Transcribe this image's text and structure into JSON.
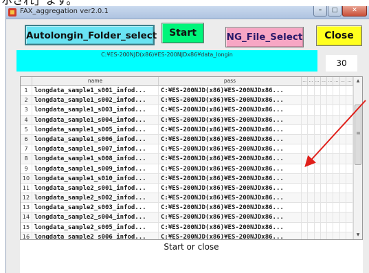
{
  "outside_text": "ホされ」ます。",
  "window": {
    "title": "FAX_aggregation  ver2.0.1",
    "controls": {
      "minimize": "–",
      "maximize": "□",
      "close": "✕"
    }
  },
  "toolbar": {
    "autologin_label": "Autolongin_Folder_select",
    "start_label": "Start",
    "ng_label": "NG_File_Select",
    "close_label": "Close",
    "colors": {
      "autologin": "#69e3f3",
      "start": "#00f57a",
      "ng": "#f7a6c4",
      "close": "#ffff1e"
    }
  },
  "path_display": {
    "value": "C:¥ES-200NJD(x86)¥ES-200NJDx86¥data_longin",
    "color": "#00ffff"
  },
  "count": "30",
  "table": {
    "columns": [
      "name",
      "pass",
      "...",
      "...",
      "...",
      "...",
      "...",
      "...",
      "...",
      "..."
    ],
    "rows": [
      {
        "idx": "1",
        "name": "longdata_sample1_s001_infod...",
        "pass": "C:¥ES-200NJD(x86)¥ES-200NJDx86..."
      },
      {
        "idx": "2",
        "name": "longdata_sample1_s002_infod...",
        "pass": "C:¥ES-200NJD(x86)¥ES-200NJDx86..."
      },
      {
        "idx": "3",
        "name": "longdata_sample1_s003_infod...",
        "pass": "C:¥ES-200NJD(x86)¥ES-200NJDx86..."
      },
      {
        "idx": "4",
        "name": "longdata_sample1_s004_infod...",
        "pass": "C:¥ES-200NJD(x86)¥ES-200NJDx86..."
      },
      {
        "idx": "5",
        "name": "longdata_sample1_s005_infod...",
        "pass": "C:¥ES-200NJD(x86)¥ES-200NJDx86..."
      },
      {
        "idx": "6",
        "name": "longdata_sample1_s006_infod...",
        "pass": "C:¥ES-200NJD(x86)¥ES-200NJDx86..."
      },
      {
        "idx": "7",
        "name": "longdata_sample1_s007_infod...",
        "pass": "C:¥ES-200NJD(x86)¥ES-200NJDx86..."
      },
      {
        "idx": "8",
        "name": "longdata_sample1_s008_infod...",
        "pass": "C:¥ES-200NJD(x86)¥ES-200NJDx86..."
      },
      {
        "idx": "9",
        "name": "longdata_sample1_s009_infod...",
        "pass": "C:¥ES-200NJD(x86)¥ES-200NJDx86..."
      },
      {
        "idx": "10",
        "name": "longdata_sample1_s010_infod...",
        "pass": "C:¥ES-200NJD(x86)¥ES-200NJDx86..."
      },
      {
        "idx": "11",
        "name": "longdata_sample2_s001_infod...",
        "pass": "C:¥ES-200NJD(x86)¥ES-200NJDx86..."
      },
      {
        "idx": "12",
        "name": "longdata_sample2_s002_infod...",
        "pass": "C:¥ES-200NJD(x86)¥ES-200NJDx86..."
      },
      {
        "idx": "13",
        "name": "longdata_sample2_s003_infod...",
        "pass": "C:¥ES-200NJD(x86)¥ES-200NJDx86..."
      },
      {
        "idx": "14",
        "name": "longdata_sample2_s004_infod...",
        "pass": "C:¥ES-200NJD(x86)¥ES-200NJDx86..."
      },
      {
        "idx": "15",
        "name": "longdata_sample2_s005_infod...",
        "pass": "C:¥ES-200NJD(x86)¥ES-200NJDx86..."
      },
      {
        "idx": "16",
        "name": "longdata_sample2_s006_infod...",
        "pass": "C:¥ES-200NJD(x86)¥ES-200NJDx86..."
      }
    ]
  },
  "status_text": "Start or close",
  "annotation_color": "#e0201b"
}
